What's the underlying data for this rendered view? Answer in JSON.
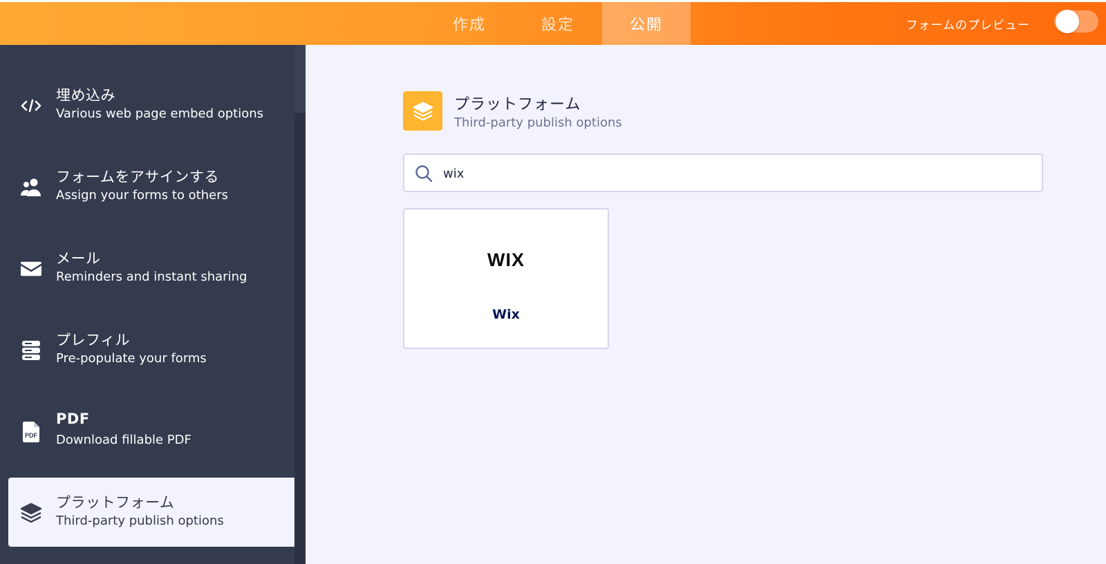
{
  "colors": {
    "brand_orange": "#ff7a15",
    "sidebar_bg": "#343b4e",
    "content_bg": "#f3f3fe",
    "platform_icon_bg": "#ffb530"
  },
  "topbar": {
    "tabs": [
      {
        "label": "作成",
        "active": false
      },
      {
        "label": "設定",
        "active": false
      },
      {
        "label": "公開",
        "active": true
      }
    ],
    "preview_label": "フォームのプレビュー",
    "preview_toggle_on": false
  },
  "sidebar": {
    "items": [
      {
        "title": "埋め込み",
        "subtitle": "Various web page embed options",
        "icon": "code-icon"
      },
      {
        "title": "フォームをアサインする",
        "subtitle": "Assign your forms to others",
        "icon": "users-icon"
      },
      {
        "title": "メール",
        "subtitle": "Reminders and instant sharing",
        "icon": "envelope-icon"
      },
      {
        "title": "プレフィル",
        "subtitle": "Pre-populate your forms",
        "icon": "database-icon"
      },
      {
        "title": "PDF",
        "subtitle": "Download fillable PDF",
        "icon": "pdf-file-icon"
      },
      {
        "title": "プラットフォーム",
        "subtitle": "Third-party publish options",
        "icon": "layers-icon",
        "active": true
      }
    ]
  },
  "main": {
    "title": "プラットフォーム",
    "subtitle": "Third-party publish options",
    "icon": "layers-icon",
    "search": {
      "value": "wix",
      "icon": "search-icon"
    },
    "results": [
      {
        "logo_text": "WIX",
        "label": "Wix"
      }
    ]
  }
}
